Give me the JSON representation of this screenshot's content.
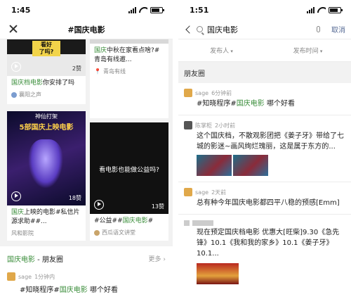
{
  "left": {
    "status": {
      "time": "1:45"
    },
    "title": "#国庆电影",
    "cards": [
      {
        "thumb_text": "看好\n了吗?",
        "title_pre": "国庆",
        "title_hl": "档电影",
        "title_post": "你安排了吗",
        "likes": "2赞",
        "source": "襄阳之声"
      },
      {
        "thumb_text": "",
        "title_pre": "国庆",
        "title_hl": "",
        "title_post": "中秋在家看点啥?#青岛有线邀...",
        "likes": "",
        "source": "青岛有线"
      },
      {
        "thumb_text": "5部国庆上映电影",
        "thumb_sub": "神仙打架",
        "title_pre": "国庆",
        "title_hl": "",
        "title_post": "上映的电影#私信片源求助##...",
        "likes": "18赞",
        "source": "风和影院"
      },
      {
        "thumb_text": "看电影也能做公益吗?",
        "title_pre": "#公益##",
        "title_hl": "国庆电影",
        "title_post": "#",
        "likes": "13赞",
        "source": "西瓜语文讲堂"
      }
    ],
    "moments": {
      "title_hl": "国庆电影",
      "title_post": " - 朋友圈",
      "more": "更多",
      "user": "sage",
      "time": "1分钟内",
      "text_pre": "#知晓程序#",
      "text_hl": "国庆电影",
      "text_post": " 哪个好看"
    }
  },
  "right": {
    "status": {
      "time": "1:51"
    },
    "search_query": "国庆电影",
    "cancel": "取消",
    "filters": [
      "发布人",
      "发布时间"
    ],
    "section": "朋友圈",
    "posts": [
      {
        "user": "sage",
        "time": "6分钟前",
        "text_pre": "#知晓程序#",
        "text_hl": "国庆电影",
        "text_post": " 哪个好看"
      },
      {
        "user": "陈掌柜",
        "time": "2小时前",
        "text": "这个国庆档，不散观影团把《姜子牙》带给了七城的影迷~画风绚烂瑰丽，这是属于东方的..."
      },
      {
        "user": "sage",
        "time": "2天前",
        "text": "总有种今年国庆电影都四平八稳的预感[Emm]"
      },
      {
        "user": "",
        "time": "",
        "text": "现在预定国庆档电影 优惠大[旺柴]9.30《急先锋》10.1《我和我的家乡》10.1《姜子牙》10.1..."
      }
    ]
  }
}
